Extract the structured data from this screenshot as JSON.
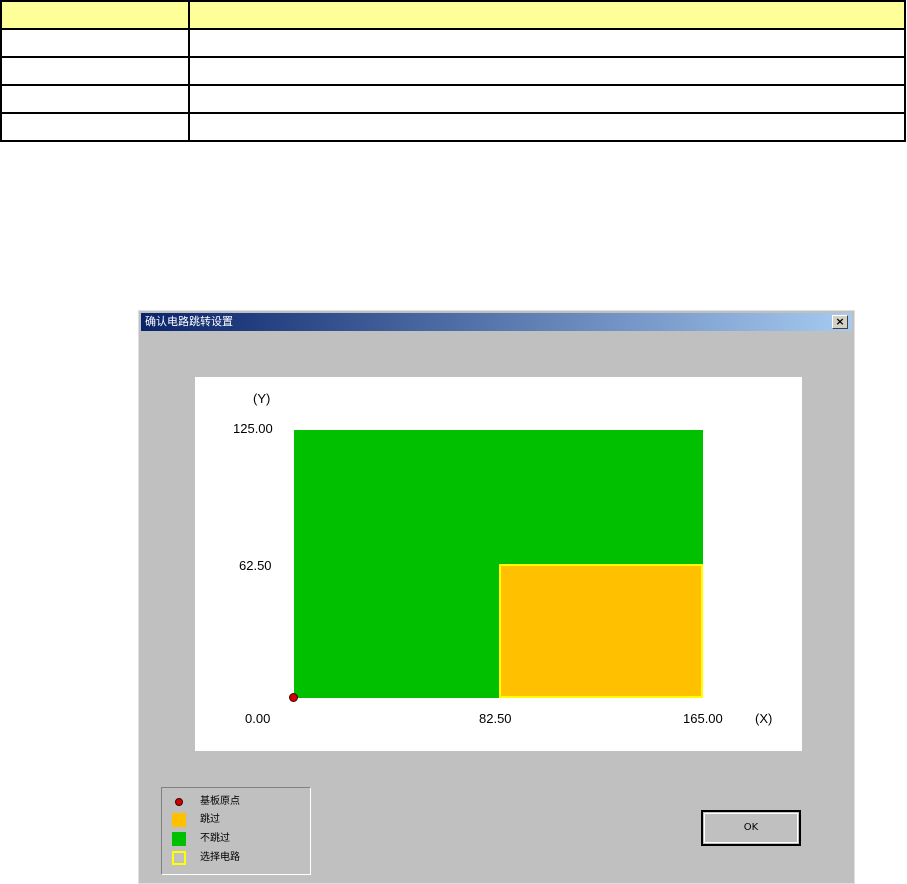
{
  "dialog": {
    "title": "确认电路跳转设置",
    "close_label": "×",
    "ok_label": "OK"
  },
  "plot": {
    "y_axis_label": "(Y)",
    "x_axis_label": "(X)",
    "y_ticks": [
      "125.00",
      "62.50"
    ],
    "x_ticks": [
      "0.00",
      "82.50",
      "165.00"
    ],
    "x_range": [
      0,
      165
    ],
    "y_range": [
      0,
      125
    ],
    "regions": [
      {
        "status": "不跳过",
        "x0": 0,
        "x1": 165,
        "y0": 0,
        "y1": 125,
        "color": "#00c000"
      },
      {
        "status": "跳过",
        "x0": 82.5,
        "x1": 165,
        "y0": 0,
        "y1": 62.5,
        "color": "#ffc000",
        "selected": true
      }
    ],
    "origin": {
      "x": 0,
      "y": 0
    }
  },
  "legend": {
    "items": [
      {
        "label": "基板原点",
        "icon": "red-dot-icon",
        "color": "#d00000"
      },
      {
        "label": "跳过",
        "icon": "orange-square-icon",
        "color": "#ffc000"
      },
      {
        "label": "不跳过",
        "icon": "green-square-icon",
        "color": "#00c000"
      },
      {
        "label": "选择电路",
        "icon": "yellow-outline-icon",
        "color": "#ffff00"
      }
    ]
  }
}
